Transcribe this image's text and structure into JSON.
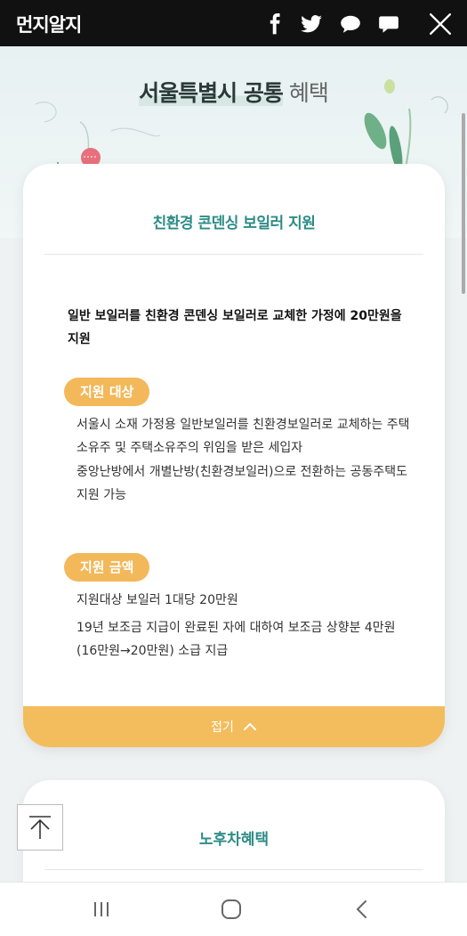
{
  "app": {
    "logo": "먼지알지"
  },
  "topbar": {
    "icons": [
      "facebook-icon",
      "twitter-icon",
      "kakaostory-icon",
      "chat-icon",
      "close-icon"
    ]
  },
  "hero": {
    "title_strong": "서울특별시 공통",
    "title_light": "혜택"
  },
  "card": {
    "title": "친환경 콘덴싱 보일러 지원",
    "summary": "일반 보일러를 친환경 콘덴싱 보일러로 교체한 가정에 20만원을 지원",
    "section1": {
      "label": "지원 대상",
      "p1": "서울시 소재 가정용 일반보일러를 친환경보일러로 교체하는 주택소유주 및 주택소유주의 위임을 받은 세입자",
      "p2": "중앙난방에서 개별난방(친환경보일러)으로 전환하는 공동주택도 지원 가능"
    },
    "section2": {
      "label": "지원 금액",
      "p1": "지원대상 보일러 1대당 20만원",
      "p2": "19년 보조금 지급이 완료된 자에 대하여 보조금 상향분 4만원(16만원→20만원) 소급 지급"
    },
    "collapse_label": "접기",
    "accent": "#f3bd5d",
    "title_color": "#2e8c86"
  },
  "card2": {
    "title": "노후차혜택"
  },
  "navbar": {
    "icons": [
      "recent-apps-icon",
      "home-icon",
      "back-icon"
    ]
  }
}
